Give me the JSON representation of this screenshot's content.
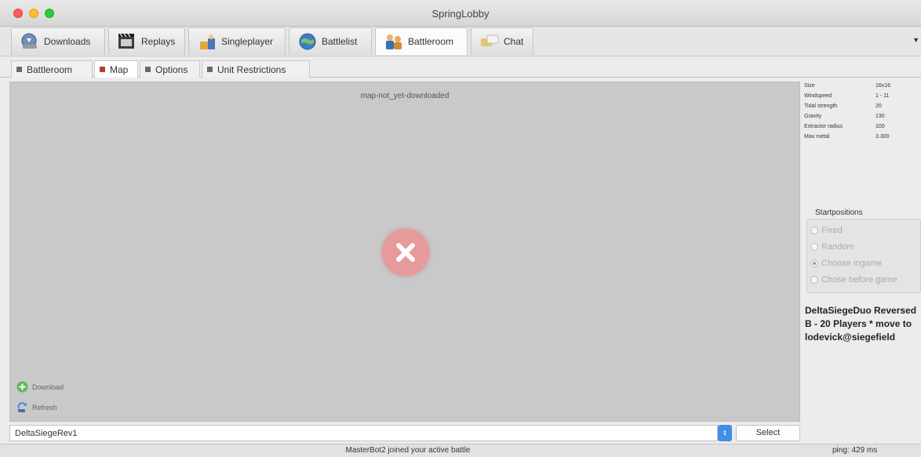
{
  "window": {
    "title": "SpringLobby"
  },
  "main_tabs": [
    {
      "label": "Downloads",
      "icon": "downloads-icon"
    },
    {
      "label": "Replays",
      "icon": "replays-icon"
    },
    {
      "label": "Singleplayer",
      "icon": "singleplayer-icon"
    },
    {
      "label": "Battlelist",
      "icon": "battlelist-icon"
    },
    {
      "label": "Battleroom",
      "icon": "battleroom-icon",
      "active": true
    },
    {
      "label": "Chat",
      "icon": "chat-icon"
    }
  ],
  "sub_tabs": [
    {
      "label": "Battleroom"
    },
    {
      "label": "Map",
      "active": true
    },
    {
      "label": "Options"
    },
    {
      "label": "Unit Restrictions"
    }
  ],
  "map_panel": {
    "map_name": "map-not_yet-downloaded",
    "download_label": "Download",
    "refresh_label": "Refresh"
  },
  "map_info": [
    {
      "key": "Size",
      "value": "16x16"
    },
    {
      "key": "Windspeed",
      "value": "1 - 11"
    },
    {
      "key": "Tidal strength",
      "value": "20"
    },
    {
      "key": "Gravity",
      "value": "130"
    },
    {
      "key": "Extractor radius",
      "value": "100"
    },
    {
      "key": "Max metal",
      "value": "3.300"
    }
  ],
  "start_positions": {
    "legend": "Startpositions",
    "options": [
      {
        "label": "Fixed",
        "selected": false
      },
      {
        "label": "Random",
        "selected": false
      },
      {
        "label": "Choose ingame",
        "selected": true
      },
      {
        "label": "Chose before game",
        "selected": false
      }
    ]
  },
  "map_description": "DeltaSiegeDuo Reversed\nB - 20 Players * move to\nlodevick@siegefield",
  "bottom": {
    "map_input_value": "DeltaSiegeRev1",
    "select_label": "Select",
    "dropdown_glyph": "⇕"
  },
  "status": {
    "message": "MasterBot2 joined your active battle",
    "ping": "ping: 429 ms"
  },
  "colors": {
    "error_circle": "#e69a9a",
    "accent_blue": "#3f8fe5"
  }
}
